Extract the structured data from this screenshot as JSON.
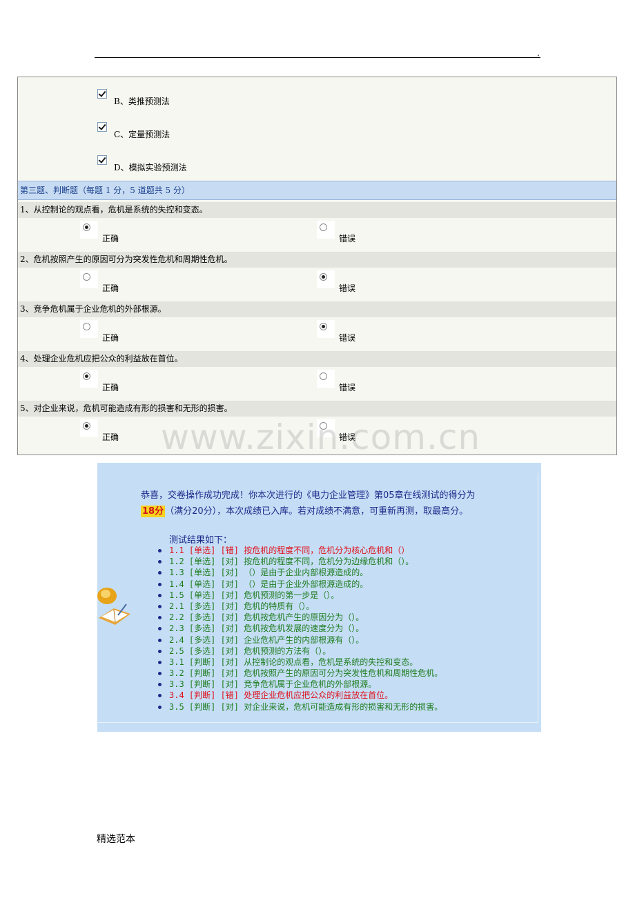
{
  "header": {
    "dot": "."
  },
  "options_prev": [
    {
      "label": "B、类推预测法",
      "checked": true
    },
    {
      "label": "C、定量预测法",
      "checked": true
    },
    {
      "label": "D、模拟实验预测法",
      "checked": true
    }
  ],
  "section3": {
    "title": "第三题、判断题（每题 1 分，5 道题共 5 分）"
  },
  "judge": {
    "true_label": "正确",
    "false_label": "错误",
    "questions": [
      {
        "stem": "1、从控制论的观点看，危机是系统的失控和变态。",
        "selected": "true"
      },
      {
        "stem": "2、危机按照产生的原因可分为突发性危机和周期性危机。",
        "selected": "false"
      },
      {
        "stem": "3、竞争危机属于企业危机的外部根源。",
        "selected": "false"
      },
      {
        "stem": "4、处理企业危机应把公众的利益放在首位。",
        "selected": "true"
      },
      {
        "stem": "5、对企业来说，危机可能造成有形的损害和无形的损害。",
        "selected": "true"
      }
    ]
  },
  "watermark": "www.zixin.com.cn",
  "result": {
    "message": "恭喜，交卷操作成功完成！你本次进行的《电力企业管理》第05章在线测试的得分为",
    "score": "18分",
    "score_tail": "（满分20分），本次成绩已入库。若对成绩不满意，可重新再测，取最高分。",
    "heading": "测试结果如下：",
    "items": [
      {
        "text": "1.1 [单选] [错] 按危机的程度不同，危机分为核心危机和（）",
        "status": "bad"
      },
      {
        "text": "1.2 [单选] [对] 按危机的程度不同，危机分为边缘危机和（）。",
        "status": "ok"
      },
      {
        "text": "1.3 [单选] [对] （）是由于企业内部根源造成的。",
        "status": "ok"
      },
      {
        "text": "1.4 [单选] [对] （）是由于企业外部根源造成的。",
        "status": "ok"
      },
      {
        "text": "1.5 [单选] [对] 危机预测的第一步是（）。",
        "status": "ok"
      },
      {
        "text": "2.1 [多选] [对] 危机的特质有（）。",
        "status": "ok"
      },
      {
        "text": "2.2 [多选] [对] 危机按危机产生的原因分为（）。",
        "status": "ok"
      },
      {
        "text": "2.3 [多选] [对] 危机按危机发展的速度分为（）。",
        "status": "ok"
      },
      {
        "text": "2.4 [多选] [对] 企业危机产生的内部根源有（）。",
        "status": "ok"
      },
      {
        "text": "2.5 [多选] [对] 危机预测的方法有（）。",
        "status": "ok"
      },
      {
        "text": "3.1 [判断] [对] 从控制论的观点看，危机是系统的失控和变态。",
        "status": "ok"
      },
      {
        "text": "3.2 [判断] [对] 危机按照产生的原因可分为突发性危机和周期性危机。",
        "status": "ok"
      },
      {
        "text": "3.3 [判断] [对] 竞争危机属于企业危机的外部根源。",
        "status": "ok"
      },
      {
        "text": "3.4 [判断] [错] 处理企业危机应把公众的利益放在首位。",
        "status": "bad"
      },
      {
        "text": "3.5 [判断] [对] 对企业来说，危机可能造成有形的损害和无形的损害。",
        "status": "ok"
      }
    ]
  },
  "footer": {
    "text": "精选范本"
  },
  "colors": {
    "ok": "#1e7c1e",
    "bad": "#e0101a",
    "section_bg": "#c7dcf3",
    "panel_bg": "#c5def6"
  }
}
